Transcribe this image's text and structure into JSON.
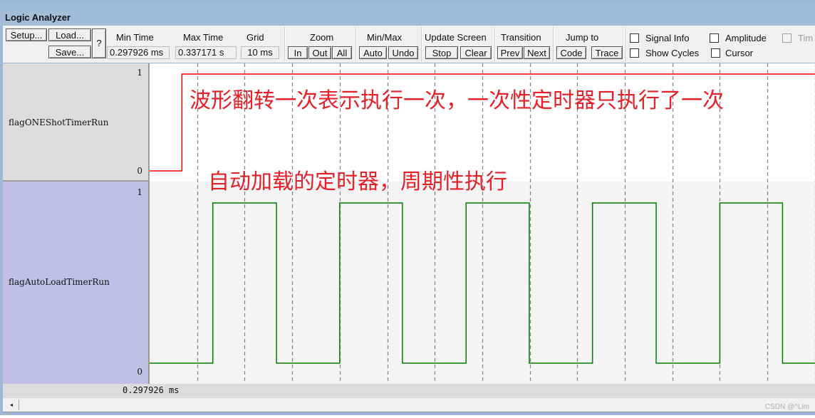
{
  "window": {
    "title": "Logic Analyzer"
  },
  "toolbar": {
    "setup": "Setup...",
    "load": "Load...",
    "save": "Save...",
    "help": "?",
    "min_time": {
      "label": "Min Time",
      "value": "0.297926 ms"
    },
    "max_time": {
      "label": "Max Time",
      "value": "0.337171 s"
    },
    "grid": {
      "label": "Grid",
      "value": "10 ms"
    },
    "zoom": {
      "label": "Zoom",
      "in": "In",
      "out": "Out",
      "all": "All"
    },
    "minmax": {
      "label": "Min/Max",
      "auto": "Auto",
      "undo": "Undo"
    },
    "update": {
      "label": "Update Screen",
      "stop": "Stop",
      "clear": "Clear"
    },
    "transition": {
      "label": "Transition",
      "prev": "Prev",
      "next": "Next"
    },
    "jump": {
      "label": "Jump to",
      "code": "Code",
      "trace": "Trace"
    },
    "checkboxes": {
      "signal_info": {
        "label": "Signal Info",
        "checked": false
      },
      "show_cycles": {
        "label": "Show Cycles",
        "checked": false
      },
      "amplitude": {
        "label": "Amplitude",
        "checked": false
      },
      "cursor": {
        "label": "Cursor",
        "checked": false
      },
      "time": {
        "label": "Tim",
        "checked": false,
        "disabled": true
      }
    }
  },
  "signals": [
    {
      "name": "flagONEShotTimerRun",
      "high_label": "1",
      "low_label": "0",
      "color": "#ff0000"
    },
    {
      "name": "flagAutoLoadTimerRun",
      "high_label": "1",
      "low_label": "0",
      "color": "#008000"
    }
  ],
  "annotations": {
    "oneshot": "波形翻转一次表示执行一次，一次性定时器只执行了一次",
    "autoload": "自动加载的定时器，周期性执行"
  },
  "chart_data": {
    "type": "line",
    "grid_ms": 10,
    "x_unit": "ms",
    "x_start_ms": 0.297926,
    "visible_span_ms": 140,
    "series": [
      {
        "name": "flagONEShotTimerRun",
        "step": true,
        "transitions_ms": [
          [
            0,
            0
          ],
          [
            6.8,
            1
          ]
        ]
      },
      {
        "name": "flagAutoLoadTimerRun",
        "step": true,
        "transitions_ms": [
          [
            0,
            0
          ],
          [
            13.3,
            1
          ],
          [
            26.7,
            0
          ],
          [
            40.0,
            1
          ],
          [
            53.2,
            0
          ],
          [
            66.6,
            1
          ],
          [
            79.9,
            0
          ],
          [
            93.2,
            1
          ],
          [
            106.6,
            0
          ],
          [
            120.0,
            1
          ],
          [
            133.2,
            0
          ]
        ]
      }
    ]
  },
  "status": {
    "cursor_time": "0.297926 ms"
  },
  "scroll": {
    "left_arrow": "◂"
  },
  "watermark": "CSDN @^Lim"
}
